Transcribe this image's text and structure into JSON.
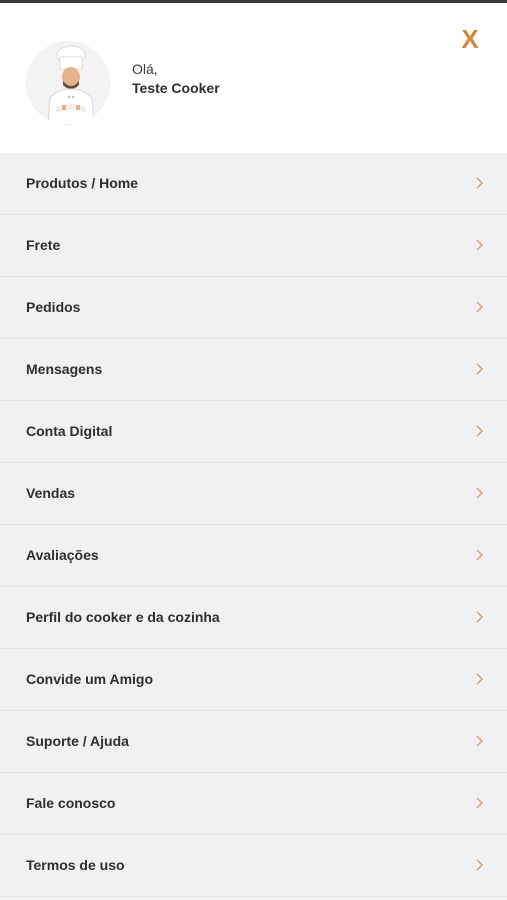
{
  "header": {
    "greeting": "Olá,",
    "user_name": "Teste Cooker",
    "close_label": "X"
  },
  "colors": {
    "accent": "#d08a3a",
    "header_bg": "#ffffff",
    "menu_bg": "#f1f1f4"
  },
  "menu": {
    "items": [
      {
        "label": "Produtos / Home"
      },
      {
        "label": "Frete"
      },
      {
        "label": "Pedidos"
      },
      {
        "label": "Mensagens"
      },
      {
        "label": "Conta Digital"
      },
      {
        "label": "Vendas"
      },
      {
        "label": "Avaliações"
      },
      {
        "label": "Perfil do cooker e da cozinha"
      },
      {
        "label": "Convide um Amigo"
      },
      {
        "label": "Suporte / Ajuda"
      },
      {
        "label": "Fale conosco"
      },
      {
        "label": "Termos de uso"
      }
    ]
  }
}
